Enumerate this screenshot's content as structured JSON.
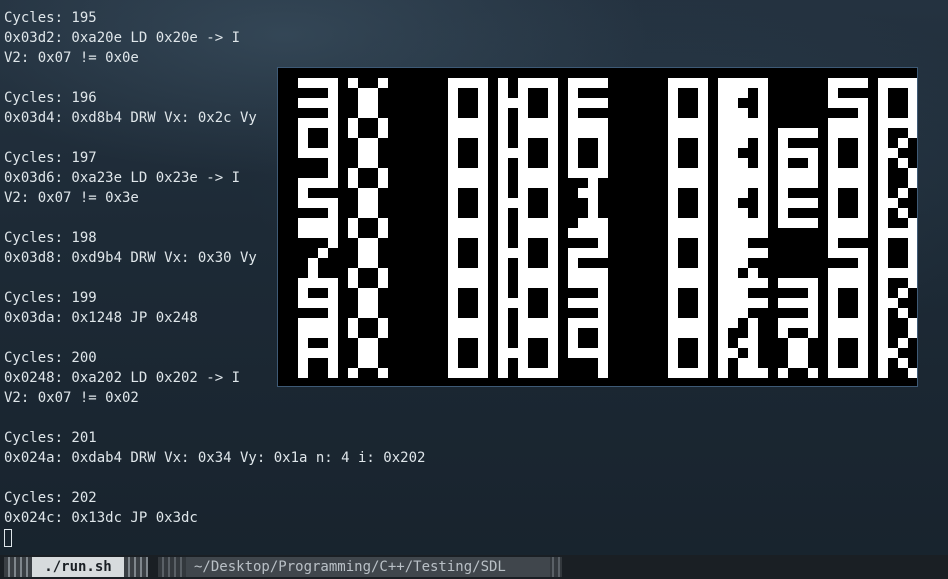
{
  "terminal": {
    "lines": [
      "Cycles: 195",
      "0x03d2: 0xa20e LD 0x20e -> I",
      "V2: 0x07 != 0x0e",
      "",
      "Cycles: 196",
      "0x03d4: 0xd8b4 DRW Vx: 0x2c Vy",
      "",
      "Cycles: 197",
      "0x03d6: 0xa23e LD 0x23e -> I",
      "V2: 0x07 != 0x3e",
      "",
      "Cycles: 198",
      "0x03d8: 0xd9b4 DRW Vx: 0x30 Vy",
      "",
      "Cycles: 199",
      "0x03da: 0x1248 JP 0x248",
      "",
      "Cycles: 200",
      "0x0248: 0xa202 LD 0x202 -> I",
      "V2: 0x07 != 0x02",
      "",
      "Cycles: 201",
      "0x024a: 0xdab4 DRW Vx: 0x34 Vy: 0x1a n: 4 i: 0x202",
      "",
      "Cycles: 202",
      "0x024c: 0x13dc JP 0x3dc"
    ]
  },
  "emulator": {
    "rows": [
      [
        "3X OK",
        "0E OK",
        "0 5OK"
      ],
      [
        "4X OK",
        "00 OK",
        "06OK"
      ],
      [
        "5X OK",
        "01 OK",
        "0EOK"
      ],
      [
        "7X OK",
        "02 OK",
        "F 5OK"
      ],
      [
        "9X OK",
        "03 OK",
        "F3OK"
      ],
      [
        "AX OK",
        "04 OK",
        "1XOK"
      ]
    ],
    "pixel_color": "#ffffff",
    "background_color": "#000000"
  },
  "statusbar": {
    "active_tab": "./run.sh",
    "path": "~/Desktop/Programming/C++/Testing/SDL"
  }
}
